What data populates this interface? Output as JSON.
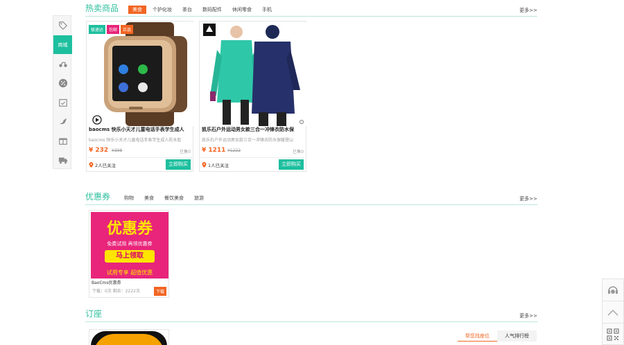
{
  "sidebar": {
    "items": [
      {
        "icon": "tag-icon",
        "label": ""
      },
      {
        "icon": "shop-icon",
        "label": "商城"
      },
      {
        "icon": "motorbike-icon",
        "label": ""
      },
      {
        "icon": "percent-icon",
        "label": ""
      },
      {
        "icon": "calendar-check-icon",
        "label": ""
      },
      {
        "icon": "dove-icon",
        "label": ""
      },
      {
        "icon": "gift-icon",
        "label": ""
      },
      {
        "icon": "truck-icon",
        "label": ""
      }
    ]
  },
  "hot": {
    "title": "热卖商品",
    "tabs": [
      "美食",
      "个护化妆",
      "茶台",
      "数码配件",
      "休闲零食",
      "手机"
    ],
    "active_tab": 0,
    "more": "更多>>",
    "products": [
      {
        "badges": [
          "极速达",
          "包邮",
          "正品"
        ],
        "title": "baocms 快乐小天才儿童电话手表学生成人",
        "subtitle": "baocms 快乐小天才儿童电话手表学生成人防水智",
        "price": "¥ 232",
        "old_price": "¥398",
        "sold": "已售0",
        "follow": "2人已关注",
        "buy": "立即购买"
      },
      {
        "badges": [],
        "brand": "KAILAS 凯乐石",
        "title": "凯乐石户外运动男女款三合一冲锋衣防水保",
        "subtitle": "凯乐石户外运动男女款三合一冲锋衣防水保暖登山",
        "price": "¥ 1211",
        "old_price": "¥1222",
        "sold": "已售0",
        "follow": "1人已关注",
        "buy": "立即购买"
      }
    ]
  },
  "coupon": {
    "title": "优惠券",
    "tabs": [
      "购物",
      "美食",
      "餐饮美食",
      "旅游"
    ],
    "more": "更多>>",
    "card": {
      "banner_big": "优惠券",
      "banner_line1": "免费试用 再领优惠券",
      "banner_btn": "马上领取",
      "banner_line2": "试用专享 超值优惠",
      "name": "BaoCms优惠券",
      "stats": "下载：0次  剩余：2222次",
      "download": "下载"
    }
  },
  "seat": {
    "title": "订座",
    "more": "更多>>",
    "tabs": [
      "帮您找座位",
      "人气排行榜"
    ],
    "active_tab": 0
  },
  "colors": {
    "accent": "#1dbf9e",
    "orange": "#f26522",
    "title": "#2cbf9c",
    "pink": "#e8257a"
  }
}
